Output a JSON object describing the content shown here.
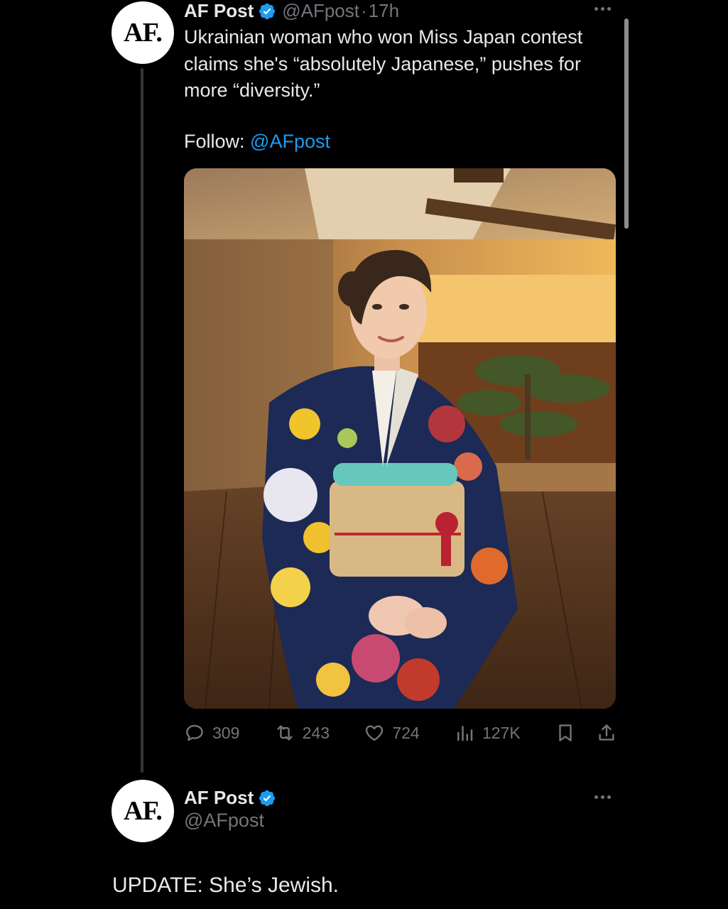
{
  "tweet": {
    "avatar_text": "AF.",
    "author_name": "AF Post",
    "handle": "@AFpost",
    "separator": "·",
    "time": "17h",
    "text": "Ukrainian woman who won Miss Japan contest claims she's “absolutely Japanese,” pushes for more “diversity.”",
    "follow_label": "Follow: ",
    "follow_mention": "@AFpost",
    "image_alt": "Woman in a colorful kimono standing in a wooden room",
    "stats": {
      "replies": "309",
      "reposts": "243",
      "likes": "724",
      "views": "127K"
    }
  },
  "reply": {
    "avatar_text": "AF.",
    "author_name": "AF Post",
    "handle": "@AFpost",
    "text": "UPDATE: She’s Jewish."
  },
  "colors": {
    "background": "#000000",
    "text": "#e7e9ea",
    "muted": "#71767b",
    "accent": "#1d9bf0",
    "verified": "#1d9bf0"
  },
  "icons": [
    "verified-badge-icon",
    "more-icon",
    "reply-icon",
    "repost-icon",
    "like-icon",
    "views-icon",
    "bookmark-icon",
    "share-icon"
  ]
}
